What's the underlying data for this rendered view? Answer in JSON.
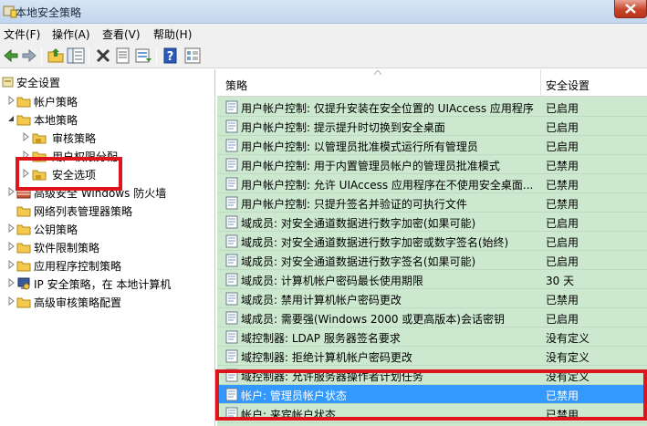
{
  "window": {
    "title": "本地安全策略"
  },
  "menu": [
    {
      "label": "文件(F)"
    },
    {
      "label": "操作(A)"
    },
    {
      "label": "查看(V)"
    },
    {
      "label": "帮助(H)"
    }
  ],
  "tree": {
    "root": "安全设置",
    "items": [
      {
        "label": "帐户策略"
      },
      {
        "label": "本地策略"
      },
      {
        "label": "审核策略"
      },
      {
        "label": "用户权限分配"
      },
      {
        "label": "安全选项"
      },
      {
        "label": "高级安全 Windows 防火墙"
      },
      {
        "label": "网络列表管理器策略"
      },
      {
        "label": "公钥策略"
      },
      {
        "label": "软件限制策略"
      },
      {
        "label": "应用程序控制策略"
      },
      {
        "label": "IP 安全策略，在 本地计算机"
      },
      {
        "label": "高级审核策略配置"
      }
    ]
  },
  "list": {
    "col_policy": "策略",
    "col_setting": "安全设置",
    "rows": [
      {
        "policy": "用户帐户控制: 仅提升安装在安全位置的 UIAccess 应用程序",
        "setting": "已启用"
      },
      {
        "policy": "用户帐户控制: 提示提升时切换到安全桌面",
        "setting": "已启用"
      },
      {
        "policy": "用户帐户控制: 以管理员批准模式运行所有管理员",
        "setting": "已启用"
      },
      {
        "policy": "用户帐户控制: 用于内置管理员帐户的管理员批准模式",
        "setting": "已禁用"
      },
      {
        "policy": "用户帐户控制: 允许 UIAccess 应用程序在不使用安全桌面...",
        "setting": "已禁用"
      },
      {
        "policy": "用户帐户控制: 只提升签名并验证的可执行文件",
        "setting": "已禁用"
      },
      {
        "policy": "域成员: 对安全通道数据进行数字加密(如果可能)",
        "setting": "已启用"
      },
      {
        "policy": "域成员: 对安全通道数据进行数字加密或数字签名(始终)",
        "setting": "已启用"
      },
      {
        "policy": "域成员: 对安全通道数据进行数字签名(如果可能)",
        "setting": "已启用"
      },
      {
        "policy": "域成员: 计算机帐户密码最长使用期限",
        "setting": "30 天"
      },
      {
        "policy": "域成员: 禁用计算机帐户密码更改",
        "setting": "已禁用"
      },
      {
        "policy": "域成员: 需要强(Windows 2000 或更高版本)会话密钥",
        "setting": "已启用"
      },
      {
        "policy": "域控制器: LDAP 服务器签名要求",
        "setting": "没有定义"
      },
      {
        "policy": "域控制器: 拒绝计算机帐户密码更改",
        "setting": "没有定义"
      },
      {
        "policy": "域控制器: 允许服务器操作者计划任务",
        "setting": "没有定义"
      },
      {
        "policy": "帐户: 管理员帐户状态",
        "setting": "已禁用"
      },
      {
        "policy": "帐户: 来宾帐户状态",
        "setting": "已禁用"
      }
    ]
  }
}
